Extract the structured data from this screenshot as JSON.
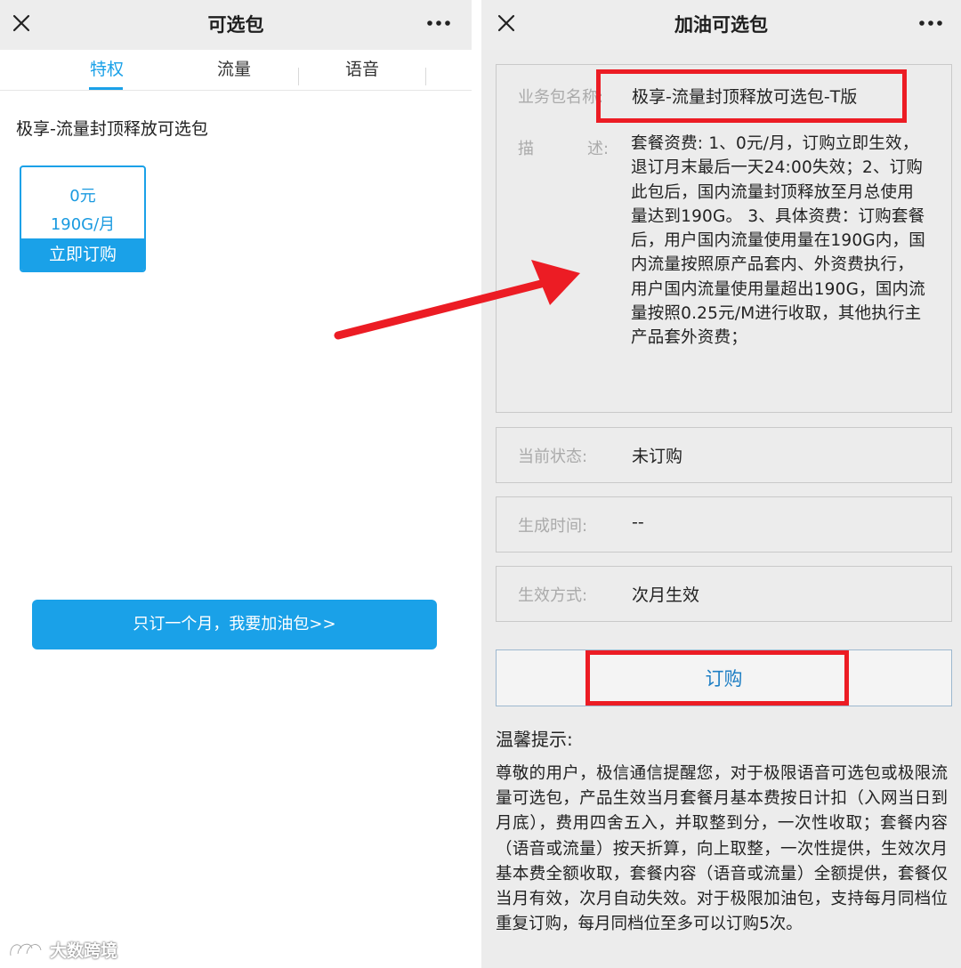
{
  "left": {
    "title": "可选包",
    "tabs": [
      {
        "label": "特权"
      },
      {
        "label": "流量"
      },
      {
        "label": "语音"
      }
    ],
    "active_tab": "特权",
    "package_title": "极享-流量封顶释放可选包",
    "package_card": {
      "price": "0元",
      "data": "190G/月",
      "button": "立即订购"
    },
    "addon_button": "只订一个月，我要加油包>>"
  },
  "right": {
    "title": "加油可选包",
    "fields": {
      "name_label": "业务包名称:",
      "name_value": "极享-流量封顶释放可选包-T版",
      "desc_label_a": "描",
      "desc_label_b": "述:",
      "desc_value": "套餐资费: 1、0元/月，订购立即生效，退订月末最后一天24:00失效；2、订购此包后，国内流量封顶释放至月总使用量达到190G。 3、具体资费：订购套餐后，用户国内流量使用量在190G内，国内流量按照原产品套内、外资费执行，用户国内流量使用量超出190G，国内流量按照0.25元/M进行收取，其他执行主产品套外资费；",
      "status_label": "当前状态:",
      "status_value": "未订购",
      "time_label": "生成时间:",
      "time_value": "--",
      "effect_label": "生效方式:",
      "effect_value": "次月生效"
    },
    "order_button": "订购",
    "tips_heading": "温馨提示:",
    "tips_body": "尊敬的用户，极信通信提醒您，对于极限语音可选包或极限流量可选包，产品生效当月套餐月基本费按日计扣（入网当日到月底），费用四舍五入，并取整到分，一次性收取；套餐内容（语音或流量）按天折算，向上取整，一次性提供，生效次月基本费全额收取，套餐内容（语音或流量）全额提供，套餐仅当月有效，次月自动失效。对于极限加油包，支持每月同档位重复订购，每月同档位至多可以订购5次。"
  },
  "watermark": "大数跨境",
  "colors": {
    "accent": "#1aa1e8",
    "highlight_red": "#ec1c24",
    "titlebar_bg": "#ededed",
    "right_bg": "#ececec"
  },
  "icons": [
    "close-icon",
    "more-icon",
    "arrow-annotation",
    "watermark-logo-icon"
  ]
}
